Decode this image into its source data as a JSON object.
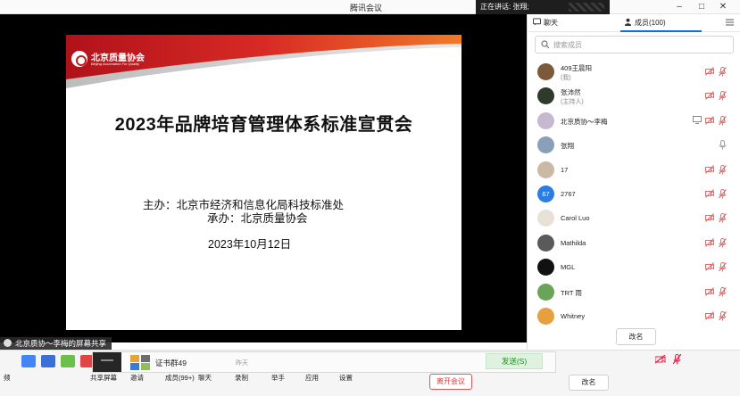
{
  "window": {
    "app_title": "腾讯会议",
    "speaking_now": "正在讲话: 张翔;"
  },
  "slide": {
    "logo_cn": "北京质量协会",
    "logo_en": "Beijing Association For Quality",
    "title": "2023年品牌培育管理体系标准宣贯会",
    "host": "主办：北京市经济和信息化局科技标准处",
    "organizer": "承办：北京质量协会",
    "date": "2023年10月12日"
  },
  "share_label": "北京质协～李梅的屏幕共享",
  "panel": {
    "tab_chat": "聊天",
    "tab_members": "成员(100)",
    "search_placeholder": "搜索成员",
    "members": [
      {
        "name": "409王晨阳",
        "role": "(我)",
        "mic": "muted",
        "avatar_color": "#7a5a3a"
      },
      {
        "name": "张沛然",
        "role": "(主持人)",
        "mic": "muted",
        "avatar_color": "#2f3b2a"
      },
      {
        "name": "北京质协～李梅",
        "role": "",
        "mic": "muted",
        "avatar_color": "#c7b8d0",
        "screen_share": true
      },
      {
        "name": "张翔",
        "role": "",
        "mic": "on",
        "avatar_color": "#8aa0b8"
      },
      {
        "name": "17",
        "role": "",
        "mic": "muted",
        "avatar_color": "#c9b9a5"
      },
      {
        "name": "2767",
        "role": "",
        "mic": "muted",
        "avatar_color": "#2a7de1",
        "avatar_text": "67"
      },
      {
        "name": "Carol Luo",
        "role": "",
        "mic": "muted",
        "avatar_color": "#e7e1d8"
      },
      {
        "name": "Mathilda",
        "role": "",
        "mic": "muted",
        "avatar_color": "#5a5a5a"
      },
      {
        "name": "MGL",
        "role": "",
        "mic": "muted",
        "avatar_color": "#111111"
      },
      {
        "name": "TRT 雨",
        "role": "",
        "mic": "muted",
        "avatar_color": "#6aa45a"
      },
      {
        "name": "Whitney",
        "role": "",
        "mic": "muted",
        "avatar_color": "#e6a040"
      }
    ],
    "rename_label": "改名"
  },
  "toolbar": {
    "items": [
      {
        "label": "频",
        "icon": "video-icon"
      },
      {
        "label": "共享屏幕",
        "icon": "share-screen-icon"
      },
      {
        "label": "邀请",
        "icon": "invite-icon"
      },
      {
        "label": "成员(99+)",
        "icon": "members-icon"
      },
      {
        "label": "聊天",
        "icon": "chat-icon"
      },
      {
        "label": "录制",
        "icon": "record-icon"
      },
      {
        "label": "举手",
        "icon": "raise-hand-icon"
      },
      {
        "label": "应用",
        "icon": "apps-icon"
      },
      {
        "label": "设置",
        "icon": "settings-icon"
      }
    ],
    "leave_label": "离开会议",
    "rename_label": "改名"
  },
  "taskbar_popup": {
    "group_name": "证书群49",
    "time": "昨天",
    "send_label": "发送(S)"
  },
  "colors": {
    "accent": "#0b6ee8",
    "danger": "#d83b3b",
    "slide_red": "#c8191b"
  }
}
